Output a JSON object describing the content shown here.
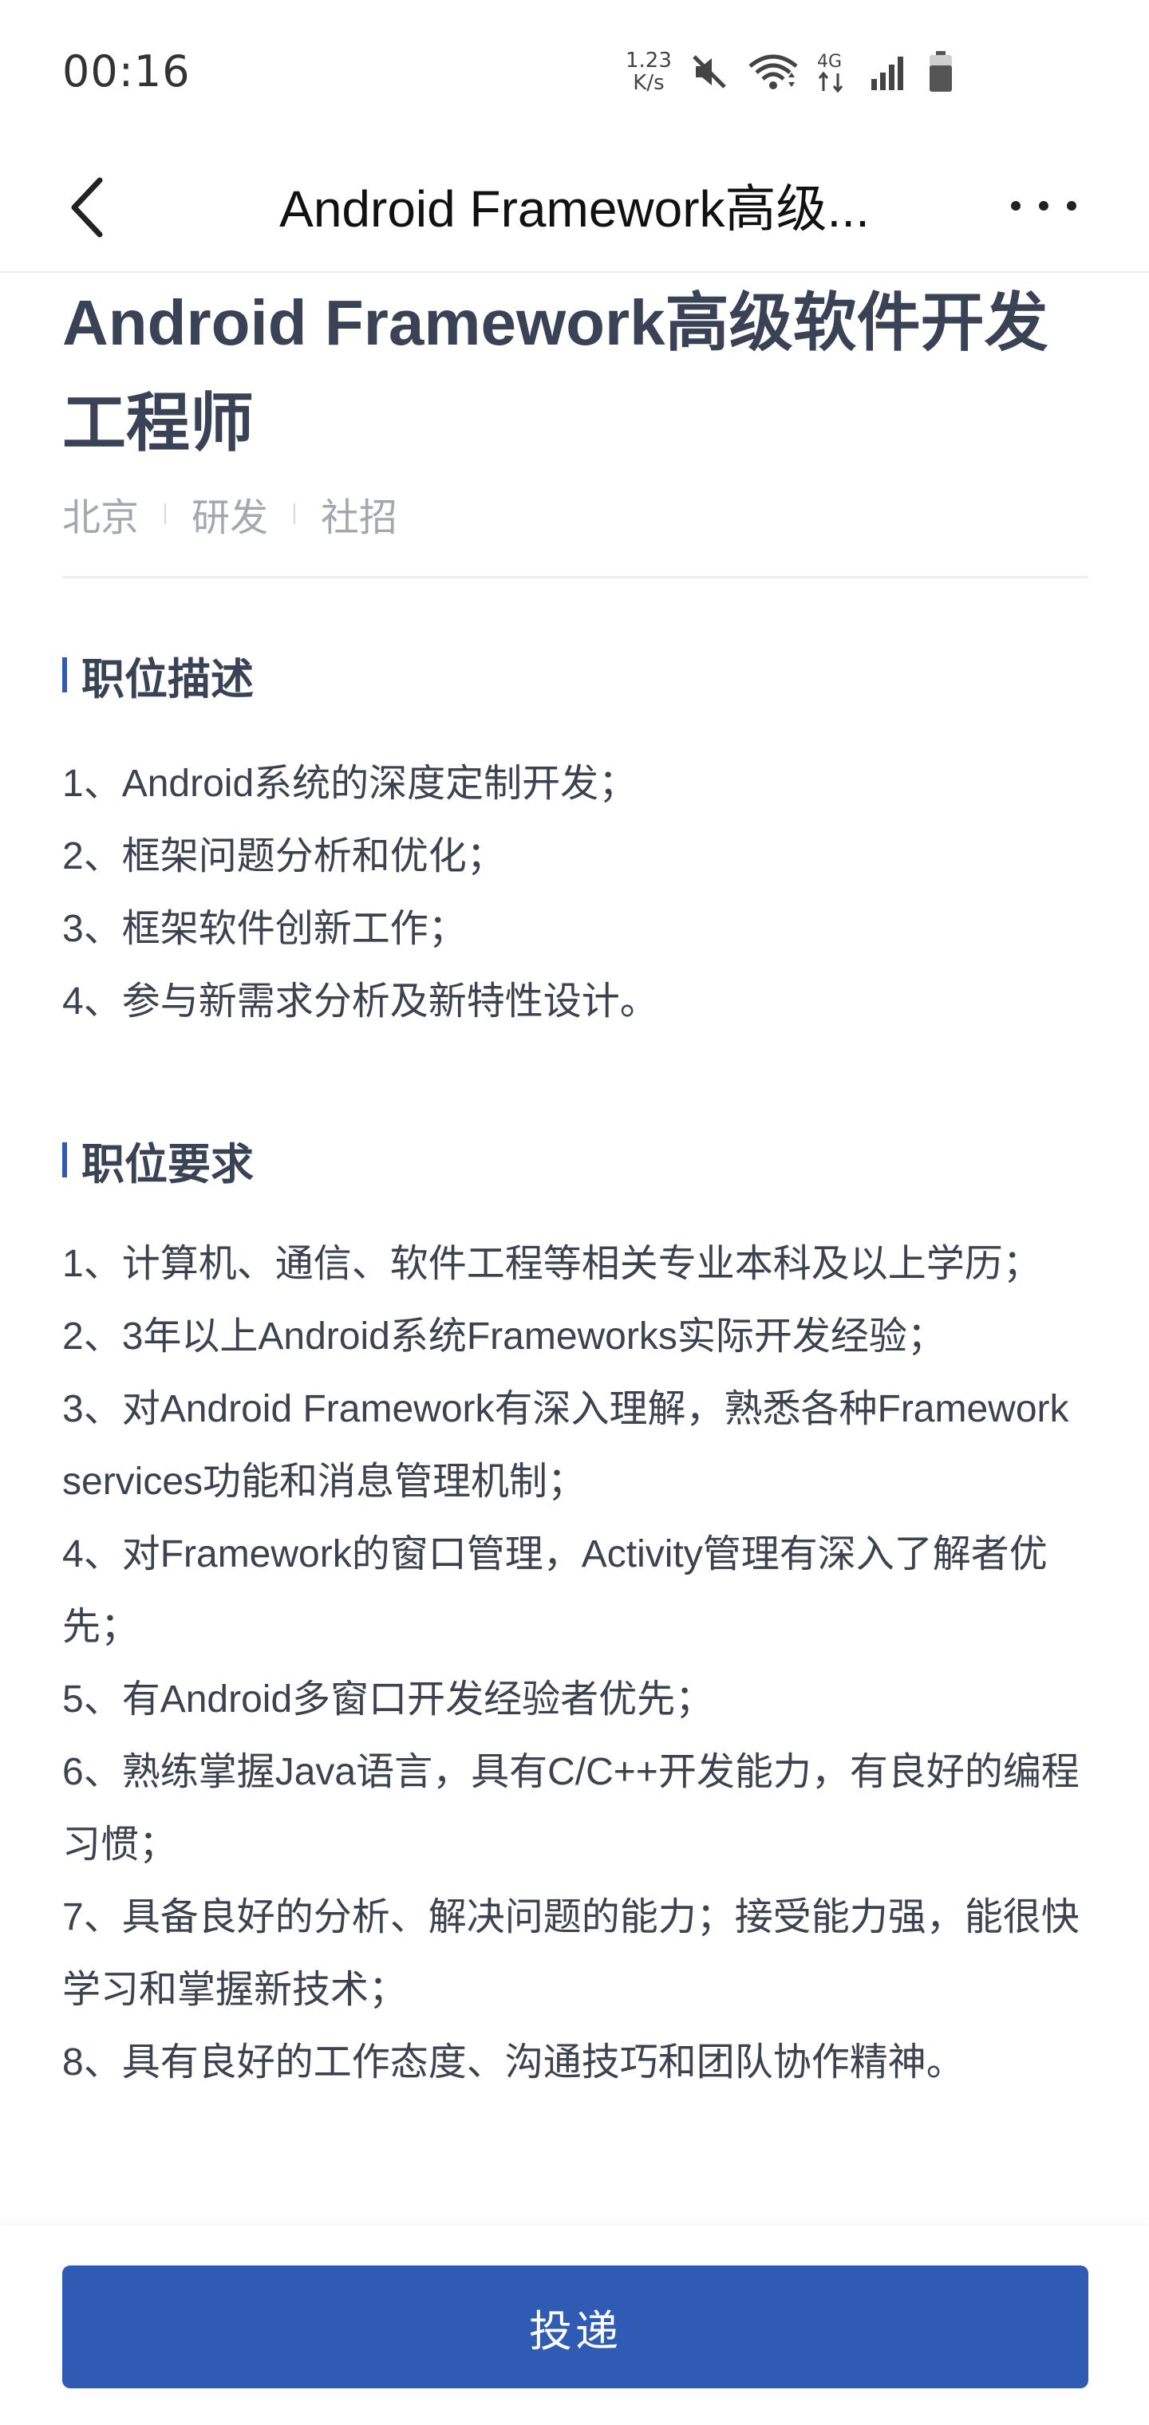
{
  "status_bar": {
    "time": "00:16",
    "net_speed_value": "1.23",
    "net_speed_unit": "K/s",
    "network_type": "4G",
    "icons": [
      "mute-icon",
      "wifi-icon",
      "mobile-data-icon",
      "signal-icon",
      "battery-icon"
    ]
  },
  "nav": {
    "title": "Android Framework高级...",
    "back_icon": "chevron-left-icon",
    "more_icon": "more-dots-icon"
  },
  "job": {
    "title": "Android Framework高级软件开发工程师",
    "tags": [
      "北京",
      "研发",
      "社招"
    ]
  },
  "sections": {
    "description": {
      "heading": "职位描述",
      "items": [
        "1、Android系统的深度定制开发；",
        "2、框架问题分析和优化；",
        "3、框架软件创新工作；",
        "4、参与新需求分析及新特性设计。"
      ]
    },
    "requirements": {
      "heading": "职位要求",
      "items": [
        "1、计算机、通信、软件工程等相关专业本科及以上学历；",
        "2、3年以上Android系统Frameworks实际开发经验；",
        "3、对Android Framework有深入理解，熟悉各种Framework services功能和消息管理机制；",
        "4、对Framework的窗口管理，Activity管理有深入了解者优先；",
        "5、有Android多窗口开发经验者优先；",
        "6、熟练掌握Java语言，具有C/C++开发能力，有良好的编程习惯；",
        "7、具备良好的分析、解决问题的能力；接受能力强，能很快学习和掌握新技术；",
        "8、具有良好的工作态度、沟通技巧和团队协作精神。"
      ]
    }
  },
  "apply_button": {
    "label": "投递"
  },
  "colors": {
    "accent": "#2f5bb5",
    "title_text": "#3a4356",
    "body_text": "#3c4250",
    "tag_text": "#a2a7b0"
  }
}
